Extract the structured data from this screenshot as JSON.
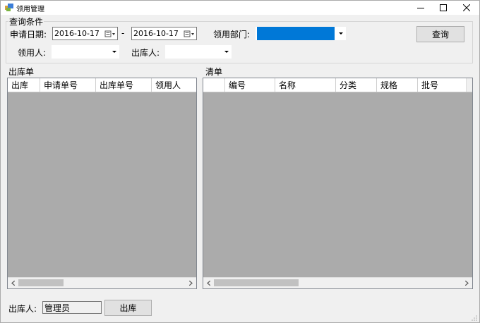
{
  "window": {
    "title": "领用管理"
  },
  "query": {
    "group_title": "查询条件",
    "apply_date_label": "申请日期:",
    "date_from": "2016-10-17",
    "date_to": "2016-10-17",
    "range_dash": "-",
    "department_label": "领用部门:",
    "recipient_label": "领用人:",
    "issuer_label": "出库人:",
    "query_button": "查询",
    "selection_color": "#0078d7"
  },
  "outbound": {
    "section_title": "出库单",
    "columns": [
      "出库",
      "申请单号",
      "出库单号",
      "领用人"
    ]
  },
  "detail": {
    "section_title": "清单",
    "columns": [
      "",
      "编号",
      "名称",
      "分类",
      "规格",
      "批号"
    ]
  },
  "footer": {
    "issuer_label": "出库人:",
    "issuer_value": "管理员",
    "outbound_button": "出库"
  }
}
